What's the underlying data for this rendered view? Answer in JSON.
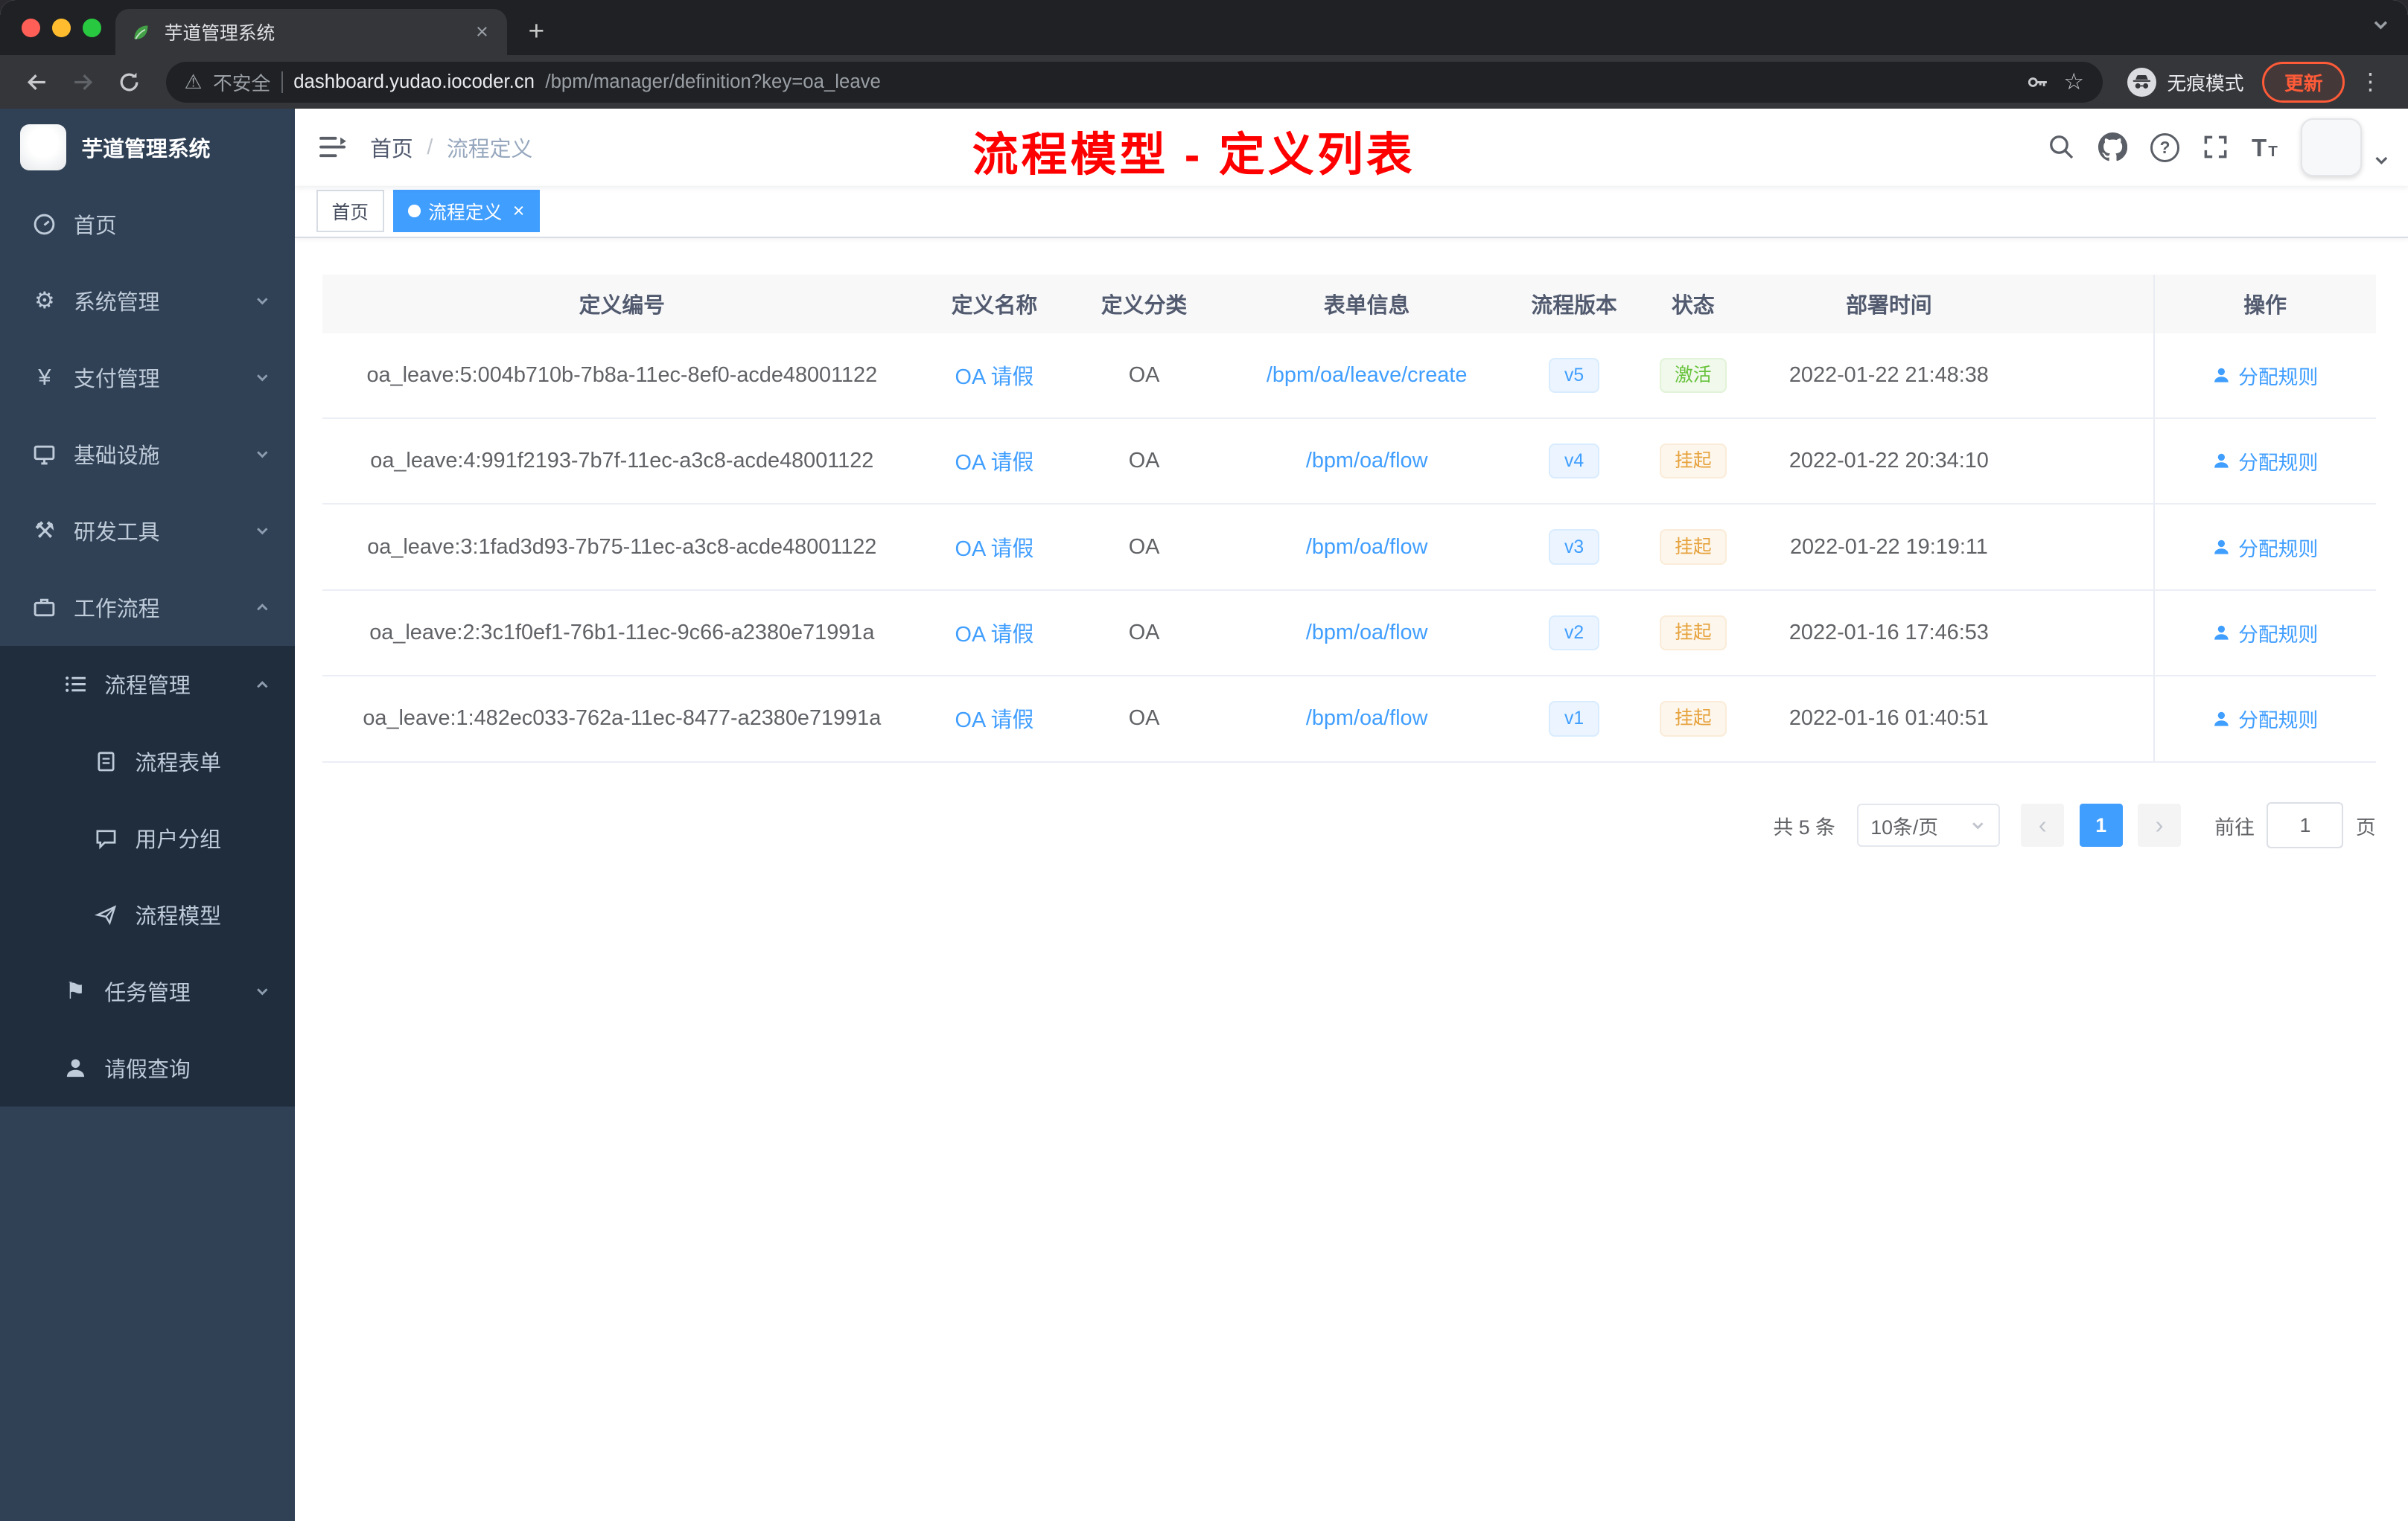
{
  "browser": {
    "tab_title": "芋道管理系统",
    "security_label": "不安全",
    "url_host": "dashboard.yudao.iocoder.cn",
    "url_path": "/bpm/manager/definition?key=oa_leave",
    "incognito_label": "无痕模式",
    "update_label": "更新"
  },
  "icons": {
    "close": "×",
    "plus": "+",
    "warning": "⚠",
    "star": "☆",
    "dots": "⋮",
    "question": "?",
    "yen": "¥",
    "gear": "⚙",
    "tools": "⚒",
    "flag": "⚑",
    "prev": "‹",
    "next": "›",
    "font_t": "T"
  },
  "sidebar": {
    "logo_title": "芋道管理系统",
    "home": "首页",
    "system": "系统管理",
    "payment": "支付管理",
    "infra": "基础设施",
    "devtools": "研发工具",
    "workflow": "工作流程",
    "process_mgmt": "流程管理",
    "process_form": "流程表单",
    "user_group": "用户分组",
    "process_model": "流程模型",
    "task_mgmt": "任务管理",
    "leave_query": "请假查询"
  },
  "header": {
    "breadcrumb_home": "首页",
    "breadcrumb_sep": "/",
    "breadcrumb_current": "流程定义",
    "annotation": "流程模型 - 定义列表"
  },
  "tags": {
    "home": "首页",
    "active": "流程定义"
  },
  "table": {
    "columns": [
      "定义编号",
      "定义名称",
      "定义分类",
      "表单信息",
      "流程版本",
      "状态",
      "部署时间",
      "操作"
    ],
    "rows": [
      {
        "id": "oa_leave:5:004b710b-7b8a-11ec-8ef0-acde48001122",
        "name": "OA 请假",
        "category": "OA",
        "form": "/bpm/oa/leave/create",
        "version": "v5",
        "status": "激活",
        "status_type": "success",
        "time": "2022-01-22 21:48:38",
        "action": "分配规则"
      },
      {
        "id": "oa_leave:4:991f2193-7b7f-11ec-a3c8-acde48001122",
        "name": "OA 请假",
        "category": "OA",
        "form": "/bpm/oa/flow",
        "version": "v4",
        "status": "挂起",
        "status_type": "warning",
        "time": "2022-01-22 20:34:10",
        "action": "分配规则"
      },
      {
        "id": "oa_leave:3:1fad3d93-7b75-11ec-a3c8-acde48001122",
        "name": "OA 请假",
        "category": "OA",
        "form": "/bpm/oa/flow",
        "version": "v3",
        "status": "挂起",
        "status_type": "warning",
        "time": "2022-01-22 19:19:11",
        "action": "分配规则"
      },
      {
        "id": "oa_leave:2:3c1f0ef1-76b1-11ec-9c66-a2380e71991a",
        "name": "OA 请假",
        "category": "OA",
        "form": "/bpm/oa/flow",
        "version": "v2",
        "status": "挂起",
        "status_type": "warning",
        "time": "2022-01-16 17:46:53",
        "action": "分配规则"
      },
      {
        "id": "oa_leave:1:482ec033-762a-11ec-8477-a2380e71991a",
        "name": "OA 请假",
        "category": "OA",
        "form": "/bpm/oa/flow",
        "version": "v1",
        "status": "挂起",
        "status_type": "warning",
        "time": "2022-01-16 01:40:51",
        "action": "分配规则"
      }
    ]
  },
  "pagination": {
    "total": "共 5 条",
    "page_size": "10条/页",
    "page": "1",
    "goto_label": "前往",
    "goto_value": "1",
    "unit": "页"
  },
  "colors": {
    "accent": "#409eff",
    "annotation": "#ff0000",
    "status_active": "#67c23a",
    "status_suspend": "#e6a23c",
    "sidebar_bg": "#304156",
    "sidebar_sub_bg": "#1f2d3d"
  }
}
